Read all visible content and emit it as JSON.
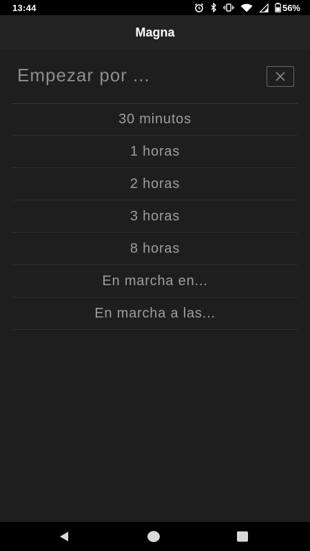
{
  "status_bar": {
    "time": "13:44",
    "battery": "56%",
    "icons": [
      "alarm-icon",
      "bluetooth-icon",
      "vibrate-icon",
      "wifi-icon",
      "cell-signal-icon",
      "battery-icon"
    ]
  },
  "app_bar": {
    "title": "Magna"
  },
  "sheet": {
    "title": "Empezar por ...",
    "close_icon": "close-icon",
    "options": [
      {
        "label": "30 minutos"
      },
      {
        "label": "1 horas"
      },
      {
        "label": "2 horas"
      },
      {
        "label": "3 horas"
      },
      {
        "label": "8 horas"
      },
      {
        "label": "En marcha en..."
      },
      {
        "label": "En marcha a las..."
      }
    ]
  },
  "nav_bar": {
    "icons": [
      "back-icon",
      "home-icon",
      "recents-icon"
    ]
  },
  "colors": {
    "background": "#1e1e1e",
    "app_bar": "#232323",
    "text": "#9e9e9e",
    "title_text": "#ffffff"
  }
}
